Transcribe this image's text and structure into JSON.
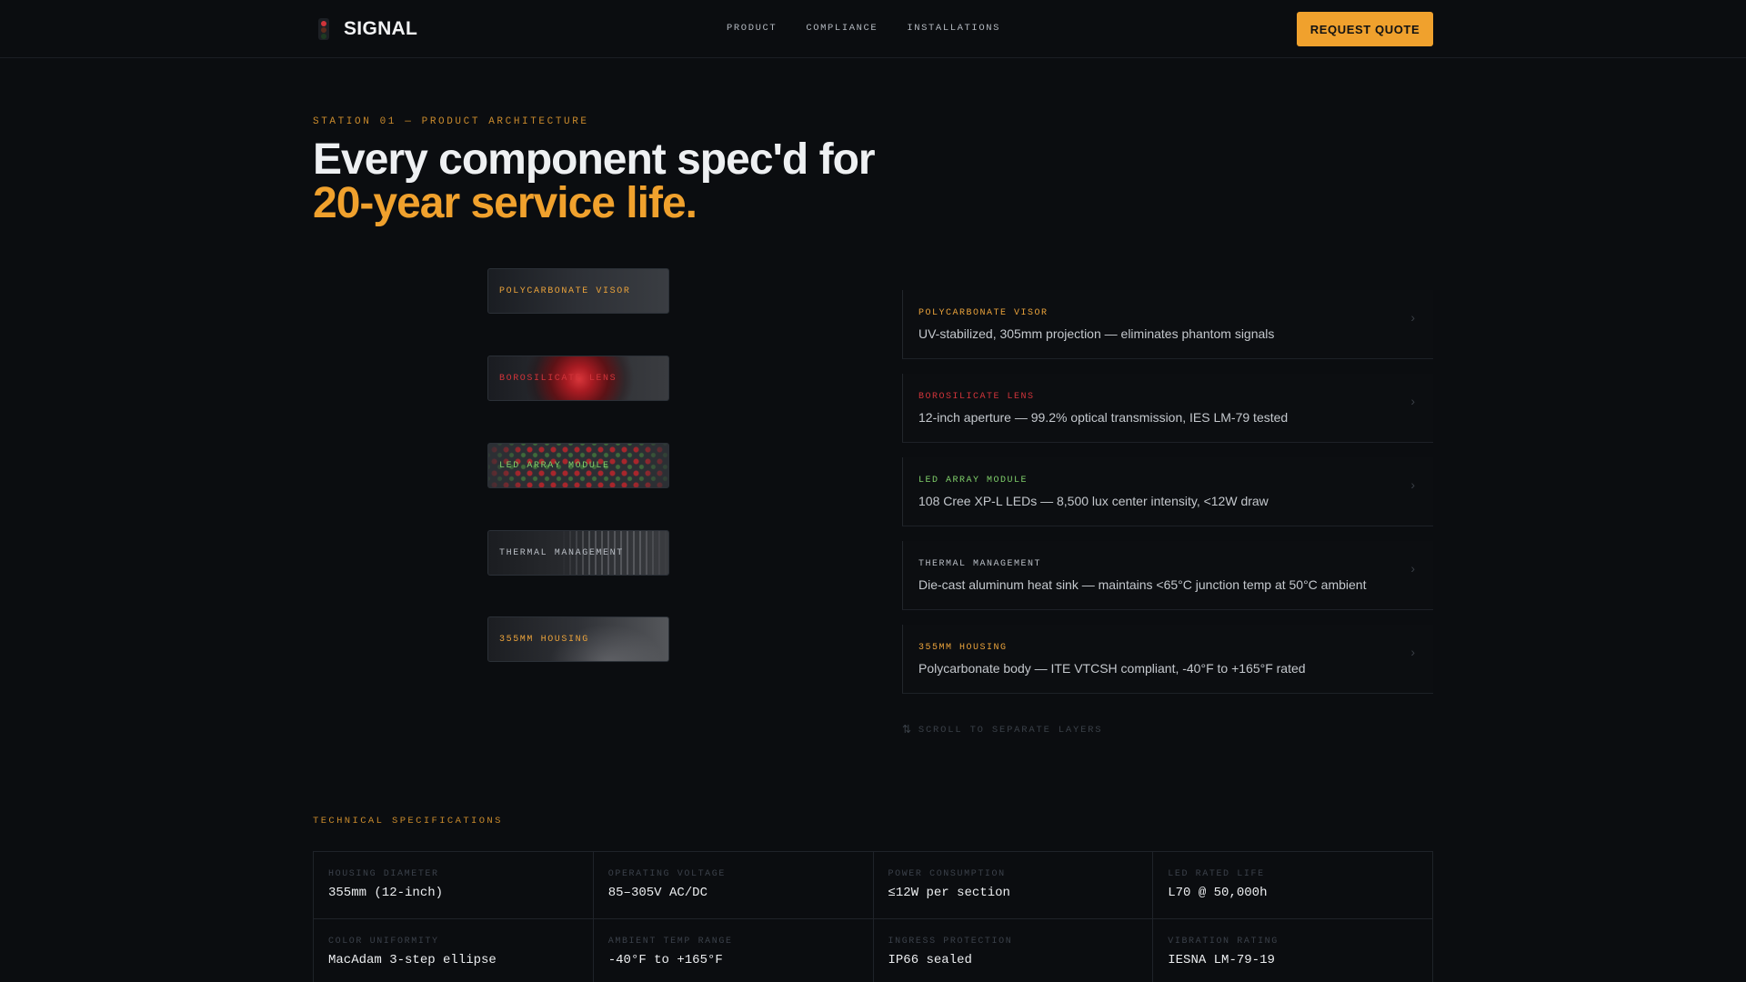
{
  "header": {
    "brand": "SIGNAL",
    "brand_icon": "traffic-light-icon",
    "nav": [
      "PRODUCT",
      "COMPLIANCE",
      "INSTALLATIONS"
    ],
    "cta": "REQUEST QUOTE",
    "colors": {
      "accent": "#f0a12d"
    }
  },
  "hero": {
    "eyebrow": "STATION 01 — PRODUCT ARCHITECTURE",
    "headline_line1": "Every component spec'd for",
    "headline_line2": "20-year service life."
  },
  "layers": [
    {
      "label": "POLYCARBONATE VISOR",
      "color": "#e9a23b"
    },
    {
      "label": "BOROSILICATE LENS",
      "color": "#d1343a"
    },
    {
      "label": "LED ARRAY MODULE",
      "color": "#7fcf6a"
    },
    {
      "label": "THERMAL MANAGEMENT",
      "color": "#b9bec5"
    },
    {
      "label": "355MM HOUSING",
      "color": "#e9a23b"
    }
  ],
  "components": [
    {
      "name": "POLYCARBONATE VISOR",
      "color": "#e9a23b",
      "desc": "UV-stabilized, 305mm projection — eliminates phantom signals"
    },
    {
      "name": "BOROSILICATE LENS",
      "color": "#d1343a",
      "desc": "12-inch aperture — 99.2% optical transmission, IES LM-79 tested"
    },
    {
      "name": "LED ARRAY MODULE",
      "color": "#7fcf6a",
      "desc": "108 Cree XP-L LEDs — 8,500 lux center intensity, <12W draw"
    },
    {
      "name": "THERMAL MANAGEMENT",
      "color": "#b9bec5",
      "desc": "Die-cast aluminum heat sink — maintains <65°C junction temp at 50°C ambient"
    },
    {
      "name": "355MM HOUSING",
      "color": "#e9a23b",
      "desc": "Polycarbonate body — ITE VTCSH compliant, -40°F to +165°F rated"
    }
  ],
  "scroll_hint": "SCROLL TO SEPARATE LAYERS",
  "technical": {
    "heading": "TECHNICAL SPECIFICATIONS",
    "rows": [
      [
        {
          "k": "HOUSING DIAMETER",
          "v": "355mm (12-inch)"
        },
        {
          "k": "OPERATING VOLTAGE",
          "v": "85–305V AC/DC"
        },
        {
          "k": "POWER CONSUMPTION",
          "v": "≤12W per section"
        },
        {
          "k": "LED RATED LIFE",
          "v": "L70 @ 50,000h"
        }
      ],
      [
        {
          "k": "COLOR UNIFORMITY",
          "v": "MacAdam 3-step ellipse"
        },
        {
          "k": "AMBIENT TEMP RANGE",
          "v": "-40°F to +165°F"
        },
        {
          "k": "INGRESS PROTECTION",
          "v": "IP66 sealed"
        },
        {
          "k": "VIBRATION RATING",
          "v": "IESNA LM-79-19"
        }
      ]
    ]
  }
}
